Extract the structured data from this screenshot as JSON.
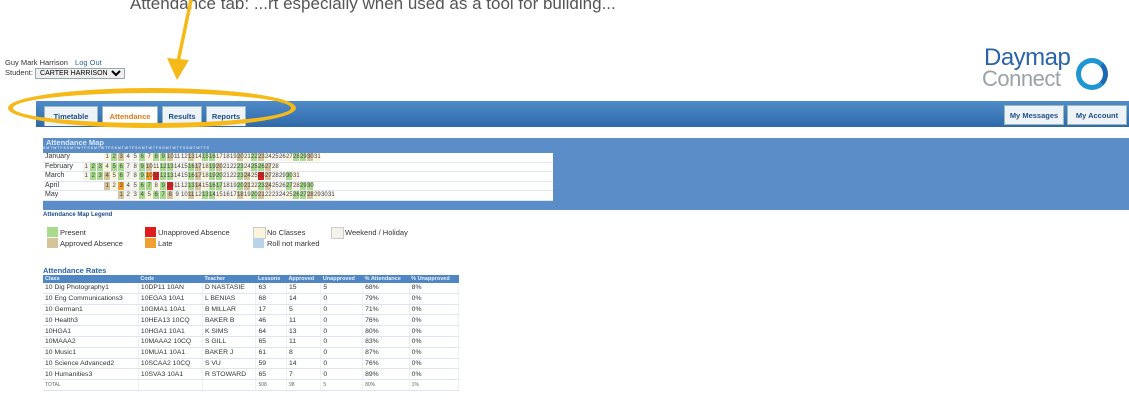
{
  "banner_text": "Attendance tab: ...rt especially when used as a tool for building...",
  "user": {
    "name": "Guy Mark Harrison",
    "logout": "Log Out",
    "student_label": "Student:",
    "student_value": "CARTER HARRISON"
  },
  "logo": {
    "line1": "Daymap",
    "line2": "Connect"
  },
  "tabs": [
    {
      "label": "Timetable"
    },
    {
      "label": "Attendance"
    },
    {
      "label": "Results"
    },
    {
      "label": "Reports"
    }
  ],
  "right_buttons": [
    {
      "label": "My Messages"
    },
    {
      "label": "My Account"
    }
  ],
  "attendance_map": {
    "title": "Attendance Map",
    "header_days": "S M T W T F S S M T W T F S S M T W T F S S M T W T F S S M T W T F S S M T W T F S S M T W T F S",
    "months": [
      {
        "name": "January",
        "start": 3,
        "days": 31
      },
      {
        "name": "February",
        "start": 0,
        "days": 28
      },
      {
        "name": "March",
        "start": 0,
        "days": 31
      },
      {
        "name": "April",
        "start": 3,
        "days": 30
      },
      {
        "name": "May",
        "start": 5,
        "days": 31
      }
    ]
  },
  "legend": {
    "title": "Attendance Map Legend",
    "items": [
      {
        "label": "Present",
        "color": "#a9d98c"
      },
      {
        "label": "Approved Absence",
        "color": "#d5c49a"
      },
      {
        "label": "Unapproved Absence",
        "color": "#e01c1c"
      },
      {
        "label": "Late",
        "color": "#f0a030"
      },
      {
        "label": "No Classes",
        "color": "#fbf3dc"
      },
      {
        "label": "Roll not marked",
        "color": "#b9d4ea"
      },
      {
        "label": "Weekend / Holiday",
        "color": "#f5f2ea"
      }
    ]
  },
  "rates": {
    "title": "Attendance Rates",
    "headers": [
      "Class",
      "Code",
      "Teacher",
      "Lessons",
      "Approved",
      "Unapproved",
      "% Attendance",
      "% Unapproved"
    ],
    "rows": [
      [
        "10 Dig Photography1",
        "10DP11 10AN",
        "D NASTASIE",
        "63",
        "15",
        "5",
        "68%",
        "8%"
      ],
      [
        "10 Eng Communications3",
        "10EGA3 10A1",
        "L BENIAS",
        "68",
        "14",
        "0",
        "79%",
        "0%"
      ],
      [
        "10 German1",
        "10GMA1 10A1",
        "B MILLAR",
        "17",
        "5",
        "0",
        "71%",
        "0%"
      ],
      [
        "10 Health3",
        "10HEA13 10CQ",
        "BAKER B",
        "46",
        "11",
        "0",
        "76%",
        "0%"
      ],
      [
        "10HGA1",
        "10HGA1 10A1",
        "K SIMS",
        "64",
        "13",
        "0",
        "80%",
        "0%"
      ],
      [
        "10MAAA2",
        "10MAAA2 10CQ",
        "S GILL",
        "65",
        "11",
        "0",
        "83%",
        "0%"
      ],
      [
        "10 Music1",
        "10MUA1 10A1",
        "BAKER J",
        "61",
        "8",
        "0",
        "87%",
        "0%"
      ],
      [
        "10 Science Advanced2",
        "10SCAA2 10CQ",
        "S VU",
        "59",
        "14",
        "0",
        "76%",
        "0%"
      ],
      [
        "10 Humanities3",
        "10SVA3 10A1",
        "R STOWARD",
        "65",
        "7",
        "0",
        "89%",
        "0%"
      ]
    ],
    "total": [
      "TOTAL",
      "",
      "",
      "508",
      "98",
      "5",
      "80%",
      "1%"
    ]
  }
}
